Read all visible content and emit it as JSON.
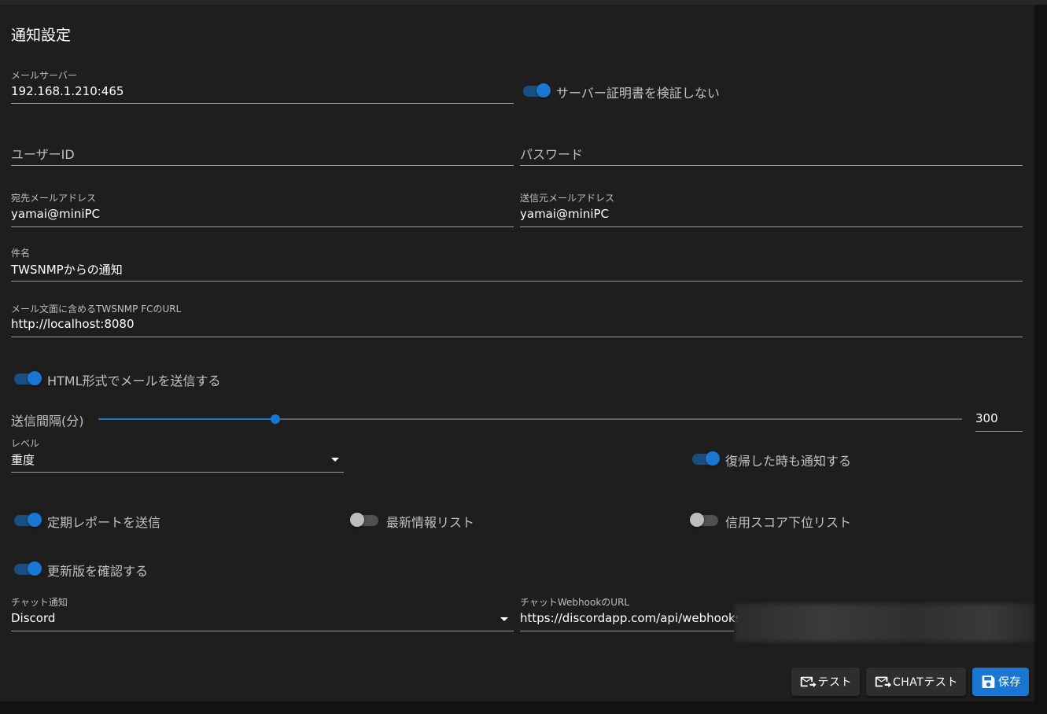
{
  "page": {
    "title": "通知設定"
  },
  "mail_server": {
    "label": "メールサーバー",
    "value": "192.168.1.210:465"
  },
  "skip_cert_verify": {
    "label": "サーバー証明書を検証しない",
    "on": true
  },
  "user_id": {
    "placeholder": "ユーザーID",
    "value": ""
  },
  "password": {
    "placeholder": "パスワード",
    "value": ""
  },
  "mail_to": {
    "label": "宛先メールアドレス",
    "value": "yamai@miniPC"
  },
  "mail_from": {
    "label": "送信元メールアドレス",
    "value": "yamai@miniPC"
  },
  "subject": {
    "label": "件名",
    "value": "TWSNMPからの通知"
  },
  "url": {
    "label": "メール文面に含めるTWSNMP FCのURL",
    "value": "http://localhost:8080"
  },
  "html_mail": {
    "label": "HTML形式でメールを送信する",
    "on": true
  },
  "interval": {
    "label": "送信間隔(分)",
    "value": "300",
    "fraction": 0.205
  },
  "level": {
    "label": "レベル",
    "value": "重度"
  },
  "notify_repair": {
    "label": "復帰した時も通知する",
    "on": true
  },
  "report": {
    "label": "定期レポートを送信",
    "on": true
  },
  "news_list": {
    "label": "最新情報リスト",
    "on": false
  },
  "low_score_list": {
    "label": "信用スコア下位リスト",
    "on": false
  },
  "check_update": {
    "label": "更新版を確認する",
    "on": true
  },
  "chat_type": {
    "label": "チャット通知",
    "value": "Discord"
  },
  "chat_url": {
    "label": "チャットWebhookのURL",
    "value": "https://discordapp.com/api/webhooks"
  },
  "buttons": {
    "test": "テスト",
    "chat_test": "CHATテスト",
    "save": "保存"
  },
  "colors": {
    "accent": "#1976d2",
    "background": "#1e1e1e"
  },
  "icons": {
    "test": "mail-send-icon",
    "chat_test": "mail-send-icon",
    "save": "floppy-disk-icon",
    "dropdown": "caret-down-icon"
  }
}
